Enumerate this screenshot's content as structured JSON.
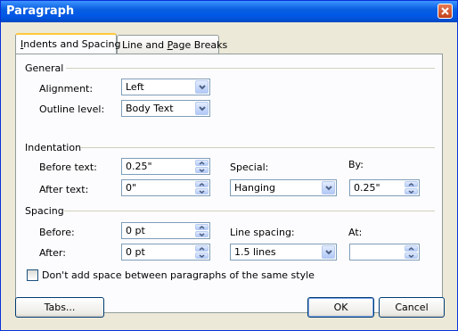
{
  "window": {
    "title": "Paragraph"
  },
  "tabs": [
    {
      "label": "Indents and Spacing",
      "underline": "I",
      "rest": "ndents and Spacing"
    },
    {
      "label": "Line and Page Breaks",
      "pre": "Line and ",
      "underline": "P",
      "post": "age Breaks"
    }
  ],
  "general": {
    "heading": "General",
    "alignment_label": "Alignment:",
    "alignment_value": "Left",
    "outline_label": "Outline level:",
    "outline_value": "Body Text"
  },
  "indentation": {
    "heading": "Indentation",
    "before_label": "Before text:",
    "before_value": "0.25\"",
    "after_label": "After text:",
    "after_value": "0\"",
    "special_label": "Special:",
    "special_value": "Hanging",
    "by_label": "By:",
    "by_value": "0.25\""
  },
  "spacing": {
    "heading": "Spacing",
    "before_label": "Before:",
    "before_value": "0 pt",
    "after_label": "After:",
    "after_value": "0 pt",
    "line_spacing_label": "Line spacing:",
    "line_spacing_value": "1.5 lines",
    "at_label": "At:",
    "at_value": ""
  },
  "checkbox": {
    "label": "Don't add space between paragraphs of the same style",
    "checked": false
  },
  "buttons": {
    "tabs": "Tabs...",
    "ok": "OK",
    "cancel": "Cancel"
  }
}
